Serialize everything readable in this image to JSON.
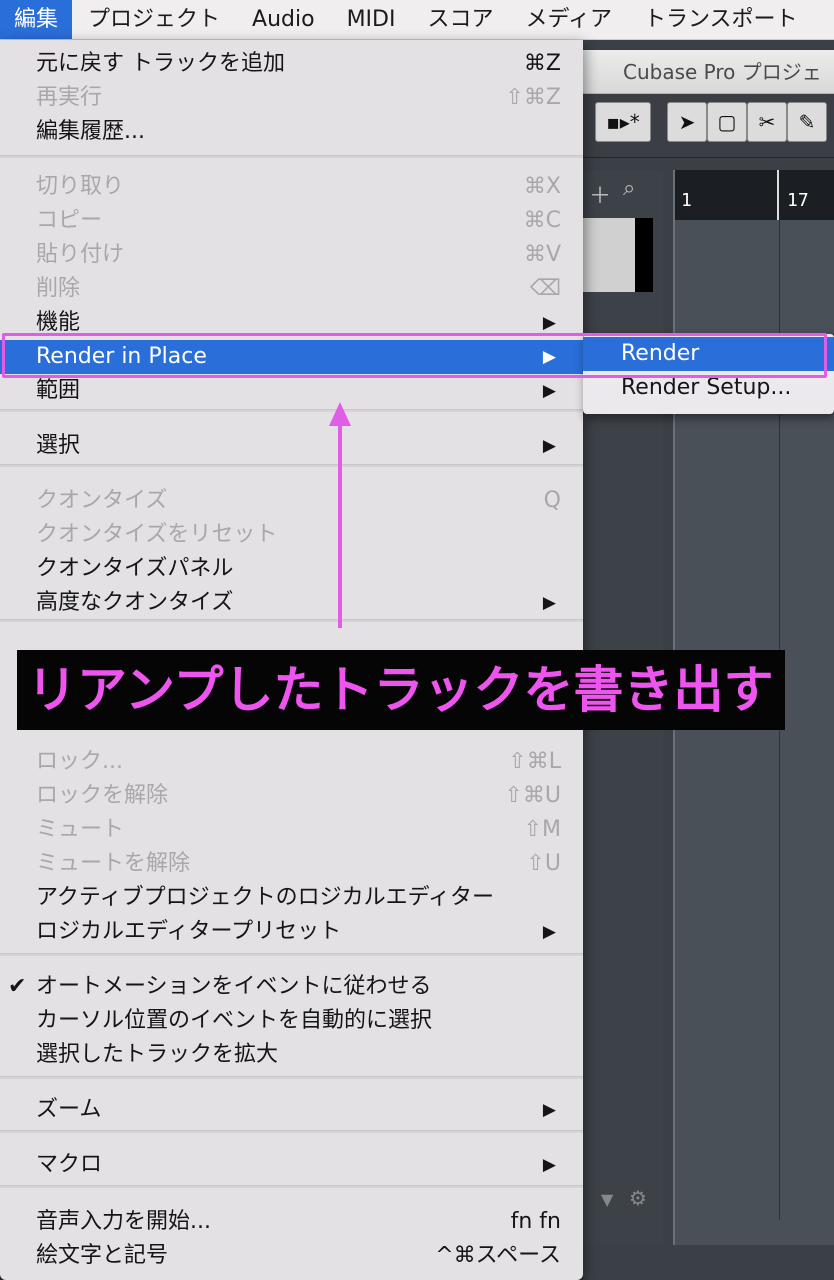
{
  "menubar": {
    "items": [
      "編集",
      "プロジェクト",
      "Audio",
      "MIDI",
      "スコア",
      "メディア",
      "トランスポート"
    ]
  },
  "app": {
    "title": "Cubase Pro プロジェ",
    "ruler_marks": [
      "1",
      "17"
    ]
  },
  "menu": {
    "items": [
      {
        "label": "元に戻す トラックを追加",
        "shortcut": "⌘Z",
        "enabled": true
      },
      {
        "label": "再実行",
        "shortcut": "⇧⌘Z",
        "enabled": false
      },
      {
        "label": "編集履歴...",
        "shortcut": "",
        "enabled": true
      },
      {
        "label": "切り取り",
        "shortcut": "⌘X",
        "enabled": false
      },
      {
        "label": "コピー",
        "shortcut": "⌘C",
        "enabled": false
      },
      {
        "label": "貼り付け",
        "shortcut": "⌘V",
        "enabled": false
      },
      {
        "label": "削除",
        "shortcut": "⌫",
        "enabled": false
      },
      {
        "label": "機能",
        "shortcut": "",
        "enabled": true,
        "submenu": true
      },
      {
        "label": "Render in Place",
        "shortcut": "",
        "enabled": true,
        "submenu": true,
        "highlighted": true
      },
      {
        "label": "範囲",
        "shortcut": "",
        "enabled": true,
        "submenu": true
      },
      {
        "label": "選択",
        "shortcut": "",
        "enabled": true,
        "submenu": true
      },
      {
        "label": "クオンタイズ",
        "shortcut": "Q",
        "enabled": false
      },
      {
        "label": "クオンタイズをリセット",
        "shortcut": "",
        "enabled": false
      },
      {
        "label": "クオンタイズパネル",
        "shortcut": "",
        "enabled": true
      },
      {
        "label": "高度なクオンタイズ",
        "shortcut": "",
        "enabled": true,
        "submenu": true
      },
      {
        "label": "ロック...",
        "shortcut": "⇧⌘L",
        "enabled": false
      },
      {
        "label": "ロックを解除",
        "shortcut": "⇧⌘U",
        "enabled": false
      },
      {
        "label": "ミュート",
        "shortcut": "⇧M",
        "enabled": false
      },
      {
        "label": "ミュートを解除",
        "shortcut": "⇧U",
        "enabled": false
      },
      {
        "label": "アクティブプロジェクトのロジカルエディター",
        "shortcut": "",
        "enabled": true
      },
      {
        "label": "ロジカルエディタープリセット",
        "shortcut": "",
        "enabled": true,
        "submenu": true
      },
      {
        "label": "オートメーションをイベントに従わせる",
        "shortcut": "",
        "enabled": true,
        "checked": true
      },
      {
        "label": "カーソル位置のイベントを自動的に選択",
        "shortcut": "",
        "enabled": true
      },
      {
        "label": "選択したトラックを拡大",
        "shortcut": "",
        "enabled": true
      },
      {
        "label": "ズーム",
        "shortcut": "",
        "enabled": true,
        "submenu": true
      },
      {
        "label": "マクロ",
        "shortcut": "",
        "enabled": true,
        "submenu": true
      },
      {
        "label": "音声入力を開始...",
        "shortcut": "fn fn",
        "enabled": true
      },
      {
        "label": "絵文字と記号",
        "shortcut": "^⌘スペース",
        "enabled": true
      }
    ]
  },
  "submenu": {
    "items": [
      {
        "label": "Render",
        "highlighted": true
      },
      {
        "label": "Render Setup..."
      }
    ]
  },
  "annotation": {
    "caption": "リアンプしたトラックを書き出す",
    "color": "#e05ee6"
  },
  "colors": {
    "accent": "#2a6ed9",
    "annotation": "#e05ee6"
  }
}
